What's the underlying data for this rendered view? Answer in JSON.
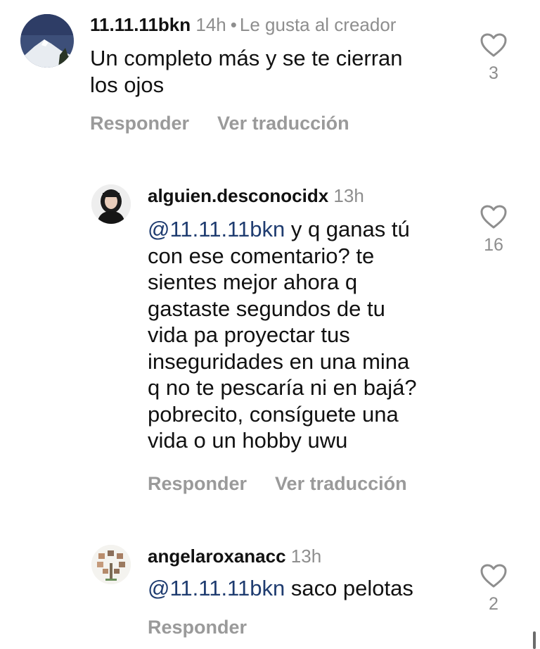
{
  "comments": [
    {
      "username": "11.11.11bkn",
      "time": "14h",
      "creator_badge": "Le gusta al creador",
      "mention": "",
      "text": "Un completo más y se te cierran\nlos ojos",
      "reply_label": "Responder",
      "translate_label": "Ver traducción",
      "likes": "3",
      "avatar_icon": "mountain-avatar-icon"
    },
    {
      "username": "alguien.desconocidx",
      "time": "13h",
      "mention": "@11.11.11bkn",
      "text": " y q ganas tú\ncon ese comentario? te\nsientes mejor ahora q\ngastaste segundos de tu\nvida pa proyectar tus\ninseguridades en una mina\nq no te pescaría ni en bajá?\npobrecito, consíguete una\nvida o un hobby uwu",
      "reply_label": "Responder",
      "translate_label": "Ver traducción",
      "likes": "16",
      "avatar_icon": "portrait-avatar-icon"
    },
    {
      "username": "angelaroxanacc",
      "time": "13h",
      "mention": "@11.11.11bkn",
      "text": " saco pelotas",
      "reply_label": "Responder",
      "likes": "2",
      "avatar_icon": "family-tree-avatar-icon"
    }
  ],
  "colors": {
    "mention": "#1f3c70",
    "secondary_text": "#8e8e8e",
    "action_text": "#9a9a9a"
  }
}
